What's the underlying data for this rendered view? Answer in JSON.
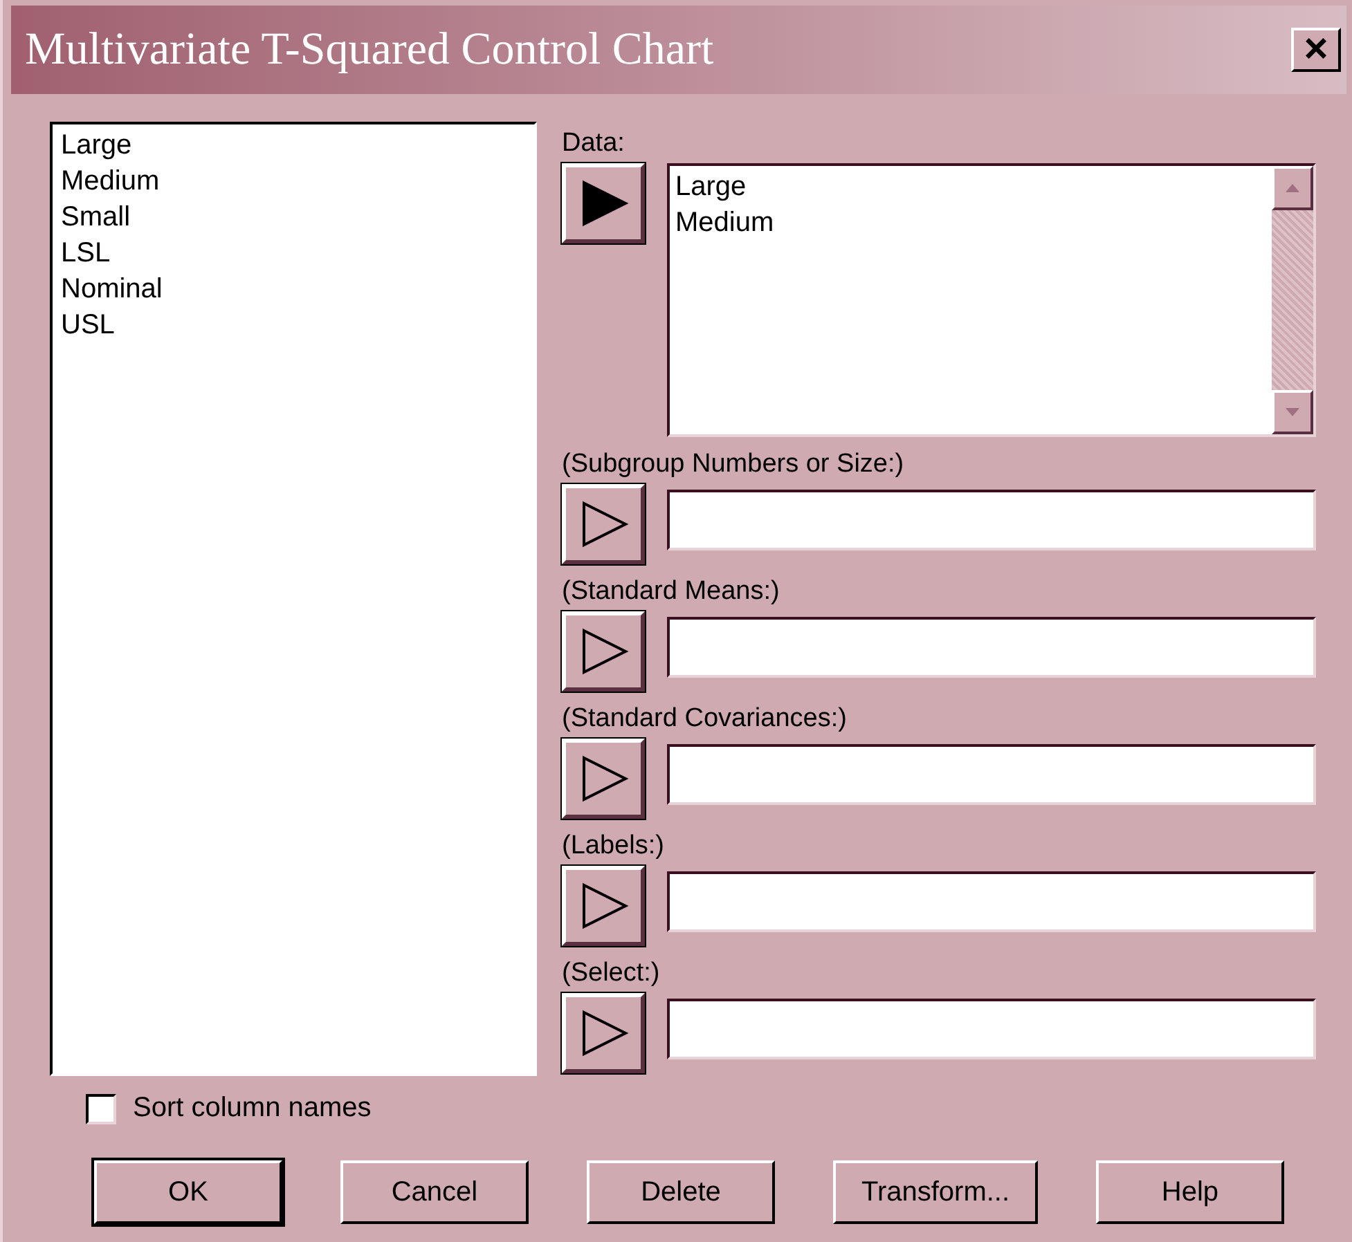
{
  "window": {
    "title": "Multivariate T-Squared Control Chart",
    "close": "×"
  },
  "columns": [
    "Large",
    "Medium",
    "Small",
    "LSL",
    "Nominal",
    "USL"
  ],
  "sort_column_names": {
    "label": "Sort column names",
    "checked": false
  },
  "data": {
    "label": "Data:",
    "arrow_active": true,
    "items": [
      "Large",
      "Medium"
    ]
  },
  "fields": [
    {
      "label": "(Subgroup Numbers or Size:)",
      "arrow_active": false
    },
    {
      "label": "(Standard Means:)",
      "arrow_active": false
    },
    {
      "label": "(Standard Covariances:)",
      "arrow_active": false
    },
    {
      "label": "(Labels:)",
      "arrow_active": false
    },
    {
      "label": "(Select:)",
      "arrow_active": false
    }
  ],
  "buttons": [
    {
      "label": "OK",
      "default": true
    },
    {
      "label": "Cancel",
      "default": false
    },
    {
      "label": "Delete",
      "default": false
    },
    {
      "label": "Transform...",
      "default": false
    },
    {
      "label": "Help",
      "default": false
    }
  ]
}
